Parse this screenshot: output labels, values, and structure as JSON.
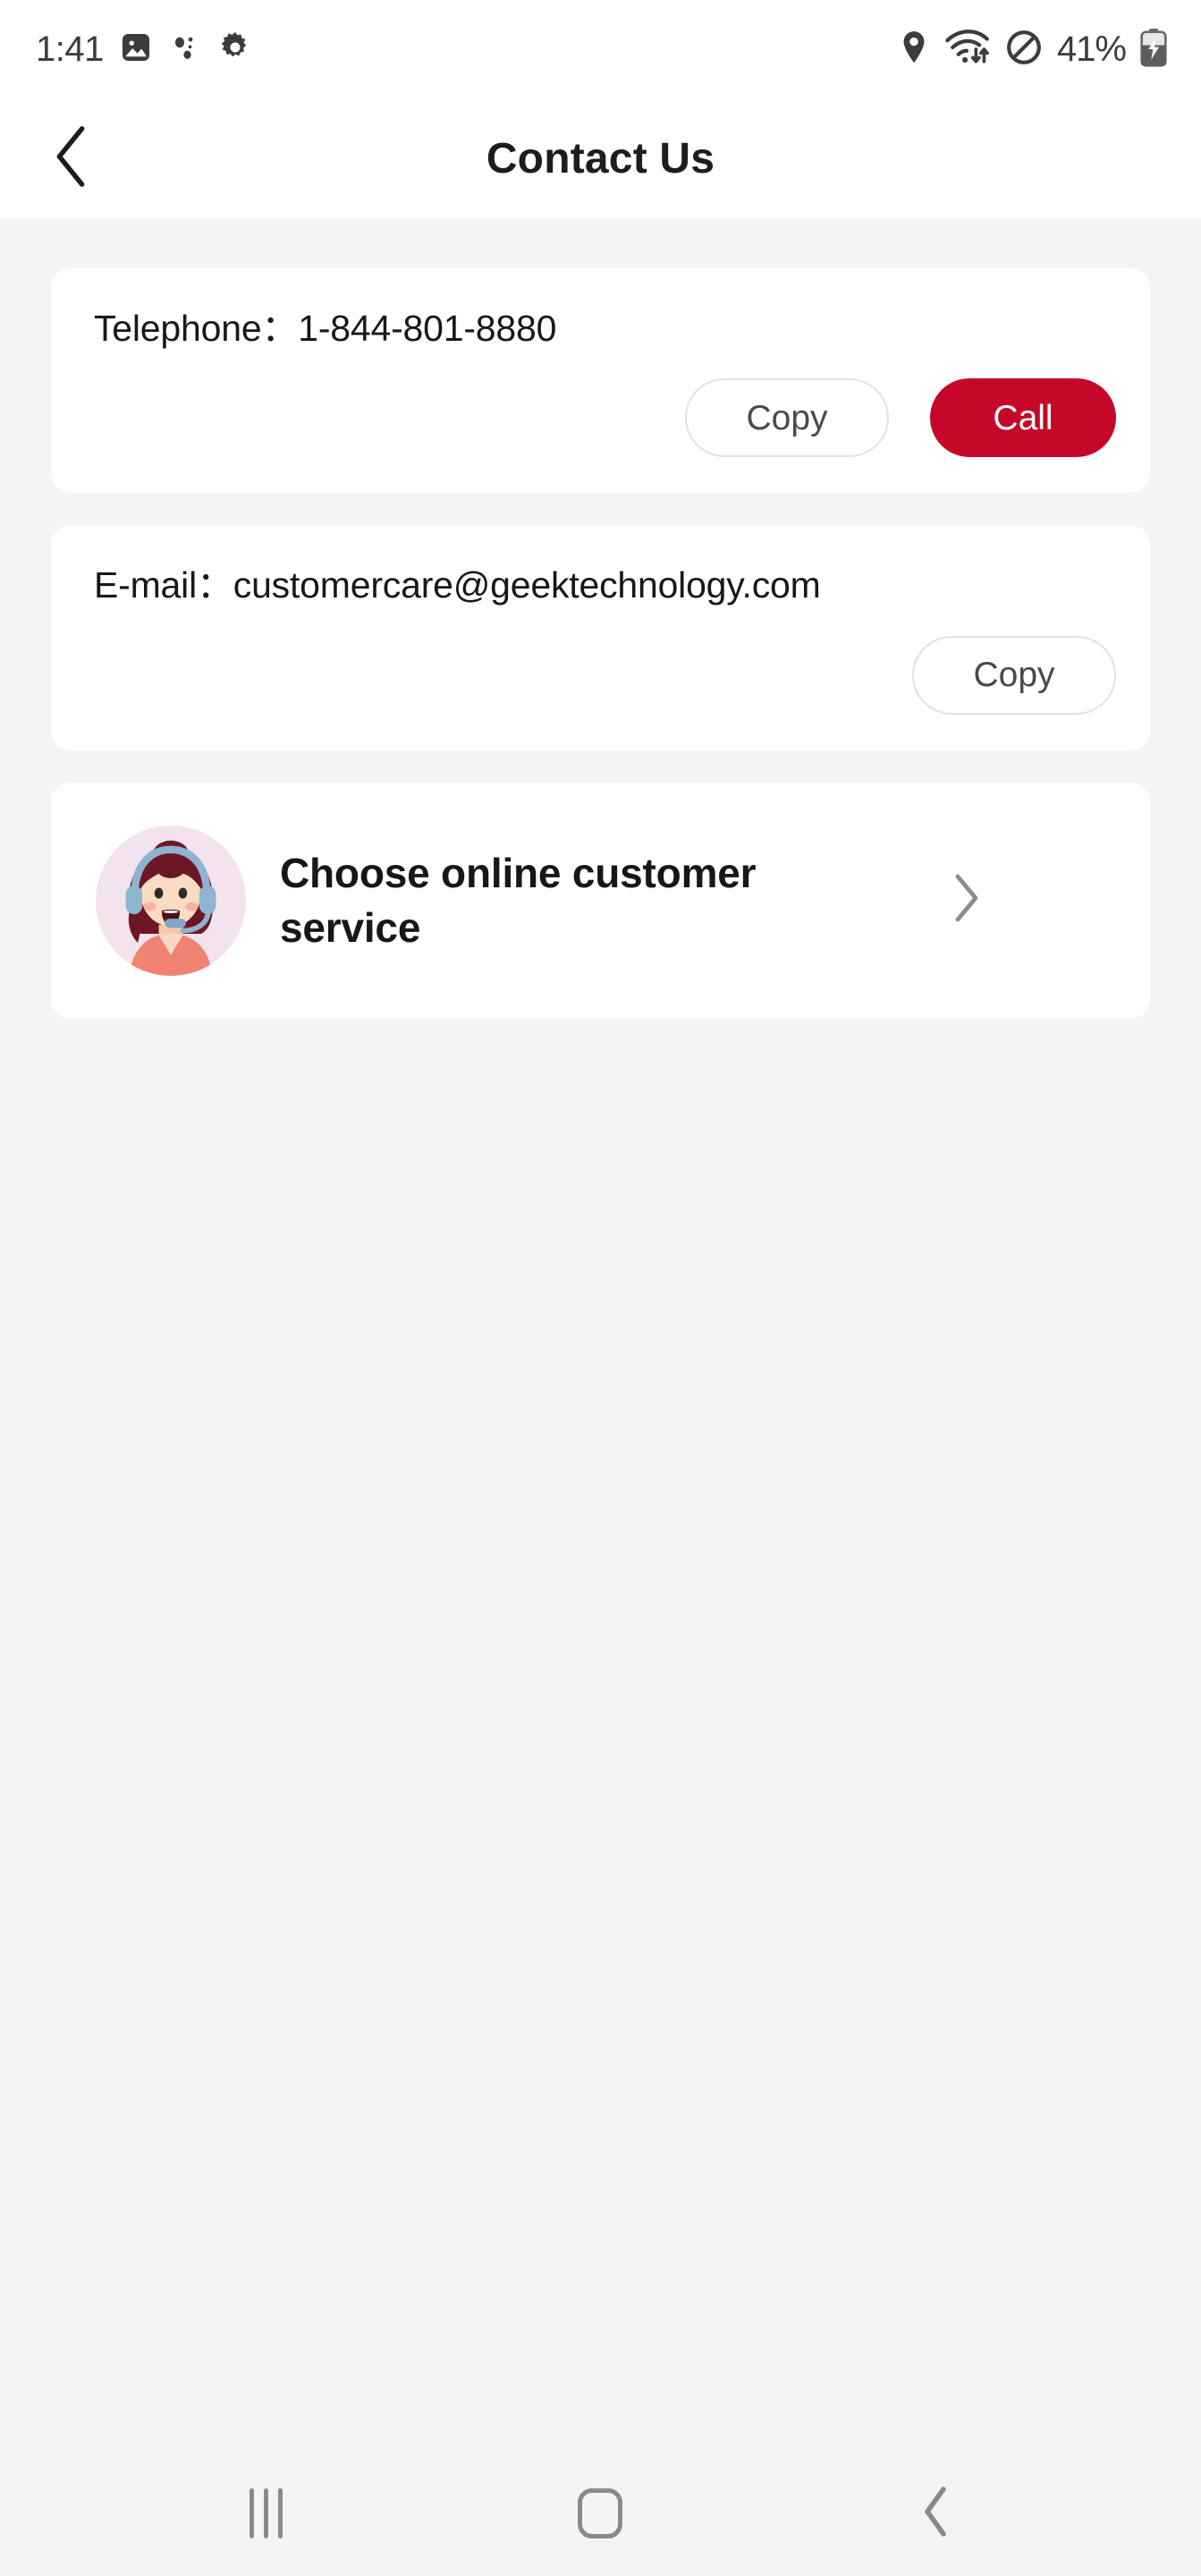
{
  "status_bar": {
    "time": "1:41",
    "left_icons": [
      "image-icon",
      "dots-icon",
      "gear-icon"
    ],
    "right_icons": [
      "location-pin-icon",
      "wifi-icon",
      "do-not-disturb-icon"
    ],
    "battery_percent": "41%",
    "battery_icon": "battery-charging-icon"
  },
  "header": {
    "back_icon": "chevron-left-icon",
    "title": "Contact Us"
  },
  "telephone_card": {
    "label": "Telephone：",
    "value": "1-844-801-8880",
    "copy_label": "Copy",
    "call_label": "Call"
  },
  "email_card": {
    "label": "E-mail：",
    "value": "customercare@geektechnology.com",
    "copy_label": "Copy"
  },
  "service_card": {
    "avatar": "customer-service-agent-avatar",
    "title": "Choose online customer service",
    "chevron_icon": "chevron-right-icon"
  },
  "nav_bar": {
    "recents_label": "recents-icon",
    "home_label": "home-icon",
    "back_label": "back-icon"
  },
  "colors": {
    "page_background": "#f4f4f4",
    "card_background": "#ffffff",
    "accent_red": "#c5082a",
    "text_primary": "#16181a",
    "text_muted": "#4a4a4a",
    "border_light": "#e2e2e2",
    "nav_icon": "#8a8a8a"
  }
}
